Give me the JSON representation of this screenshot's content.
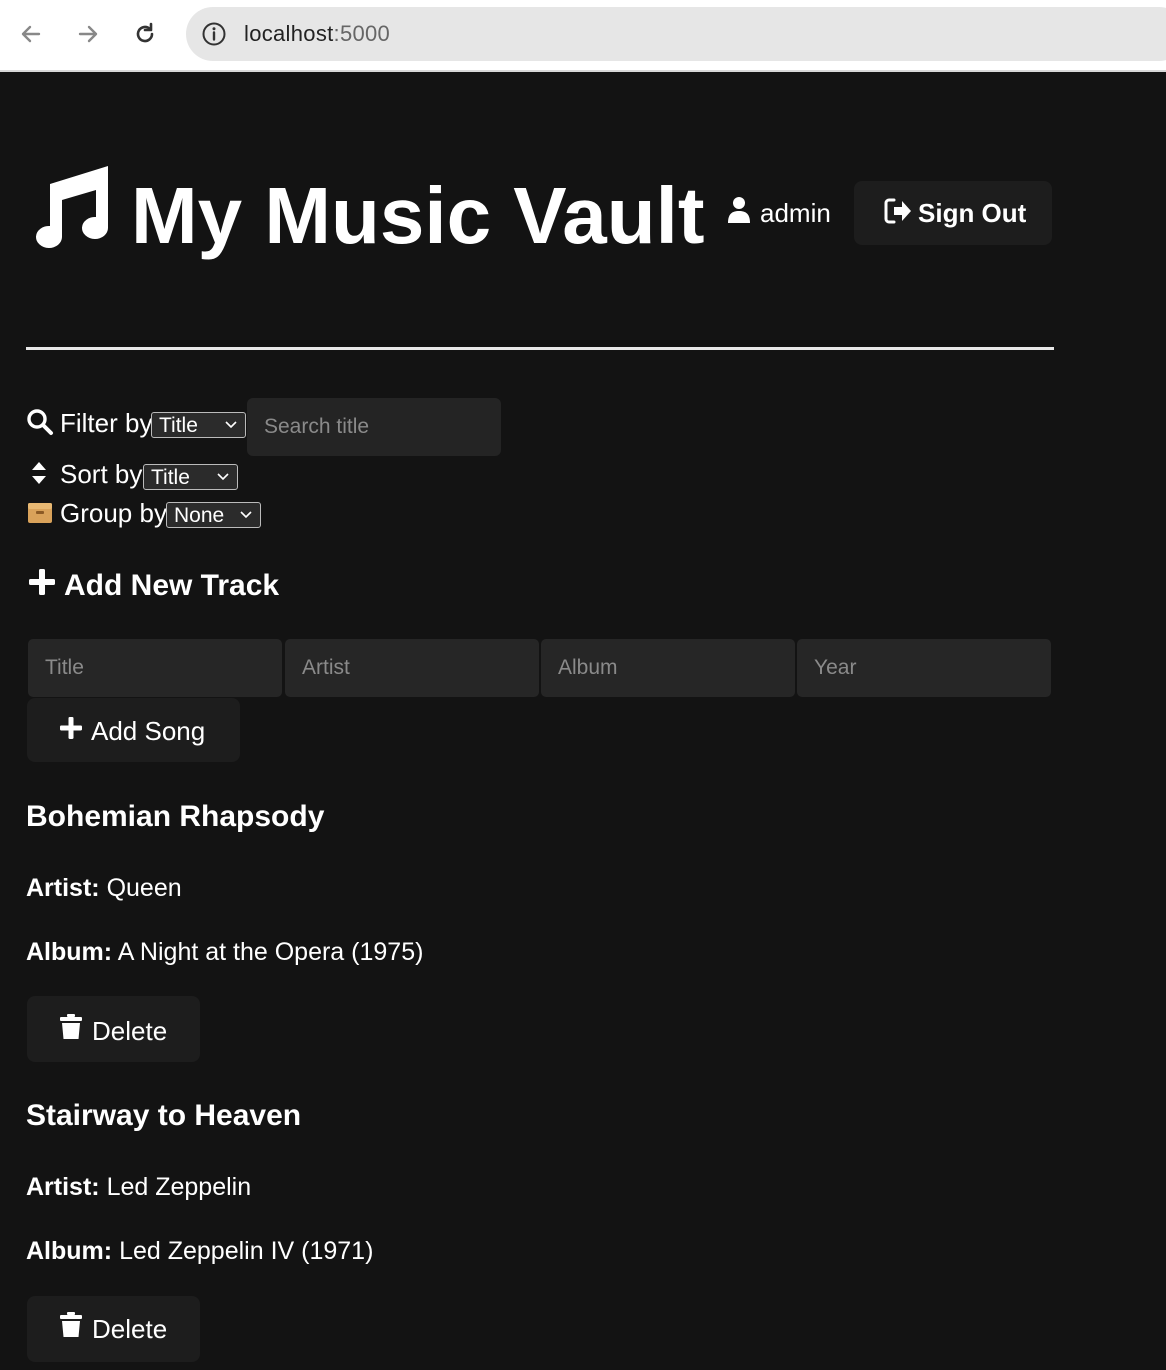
{
  "browser": {
    "url_host": "localhost",
    "url_port": ":5000"
  },
  "header": {
    "title": "My Music Vault",
    "username": "admin",
    "signout_label": "Sign Out"
  },
  "controls": {
    "filter_label": "Filter by",
    "filter_selected": "Title",
    "search_placeholder": "Search title",
    "sort_label": "Sort by",
    "sort_selected": "Title",
    "group_label": "Group by",
    "group_selected": "None"
  },
  "add_track": {
    "heading": "Add New Track",
    "title_placeholder": "Title",
    "artist_placeholder": "Artist",
    "album_placeholder": "Album",
    "year_placeholder": "Year",
    "add_button_label": "Add Song"
  },
  "songs": [
    {
      "title": "Bohemian Rhapsody",
      "artist_label": "Artist:",
      "artist": "Queen",
      "album_label": "Album:",
      "album": "A Night at the Opera (1975)",
      "delete_label": "Delete"
    },
    {
      "title": "Stairway to Heaven",
      "artist_label": "Artist:",
      "artist": "Led Zeppelin",
      "album_label": "Album:",
      "album": "Led Zeppelin IV (1971)",
      "delete_label": "Delete"
    }
  ]
}
